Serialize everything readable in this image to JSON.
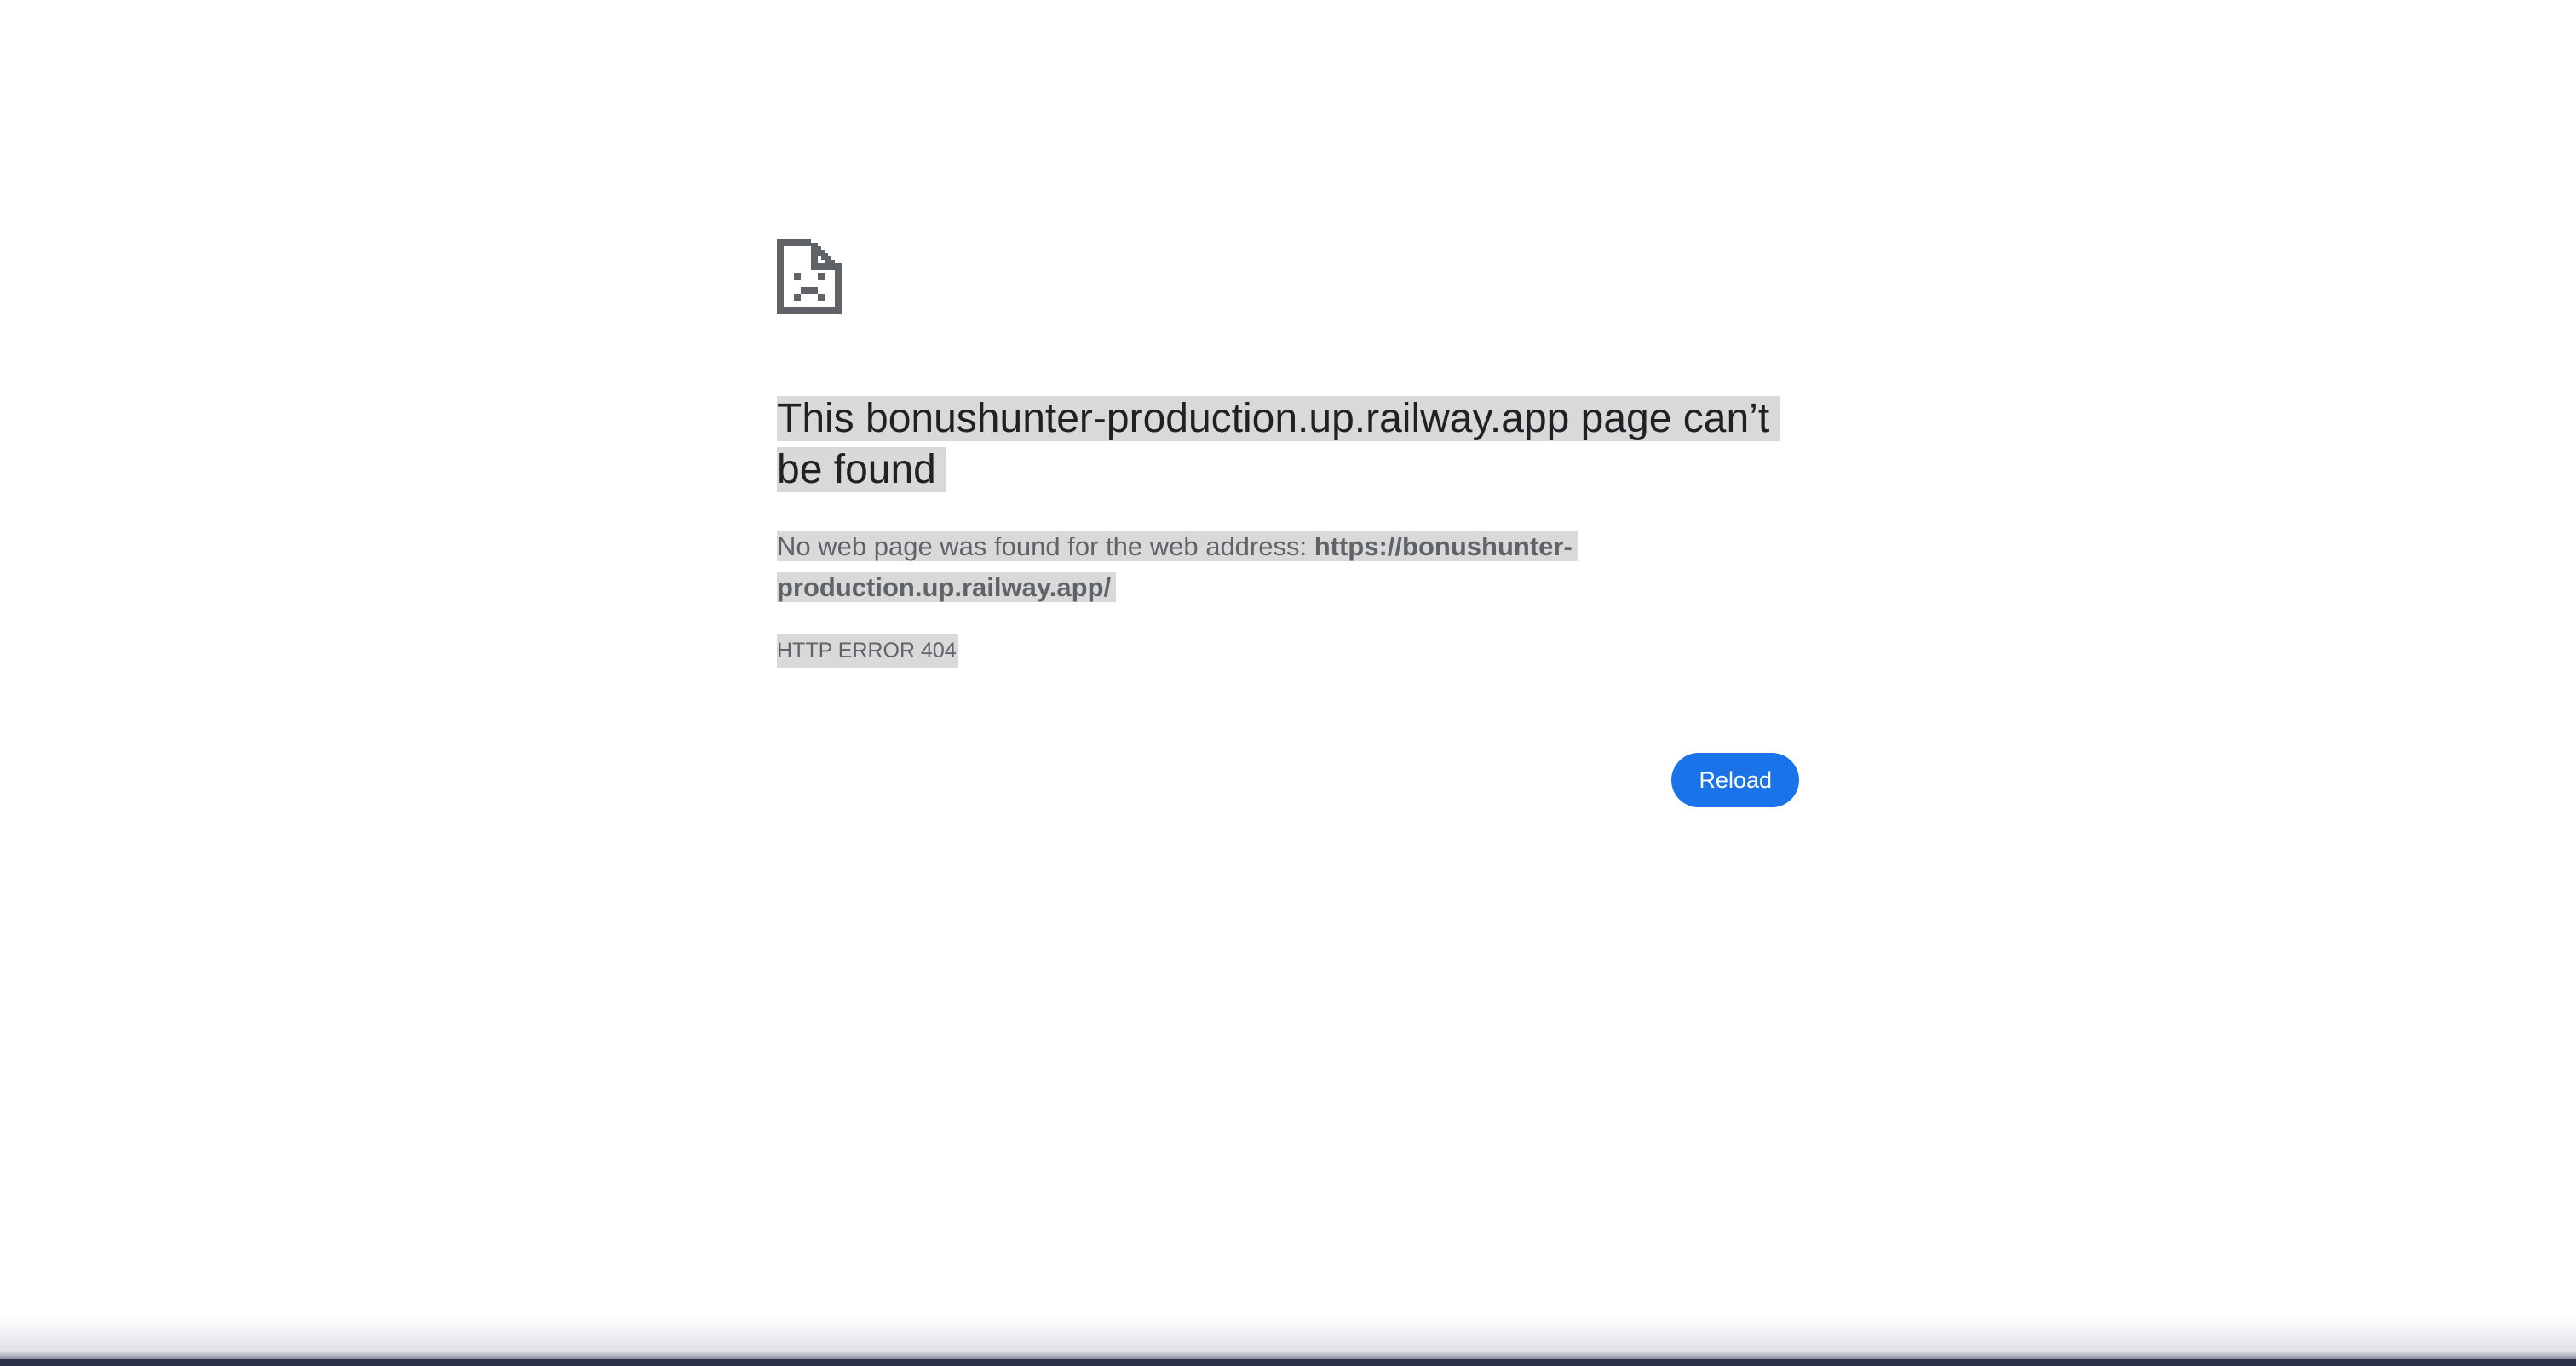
{
  "error_page": {
    "icon": "sad-document-icon",
    "title": "This bonushunter-production.up.railway.app page can’t be found",
    "description_prefix": "No web page was found for the web address: ",
    "description_url": "https://bonushunter-production.up.railway.app/",
    "error_code": "HTTP ERROR 404",
    "reload_label": "Reload"
  },
  "colors": {
    "button": "#1a73e8",
    "selection": "#d9d9d9",
    "title_text": "#202124",
    "secondary_text": "#5f6368",
    "icon": "#5f6368"
  }
}
